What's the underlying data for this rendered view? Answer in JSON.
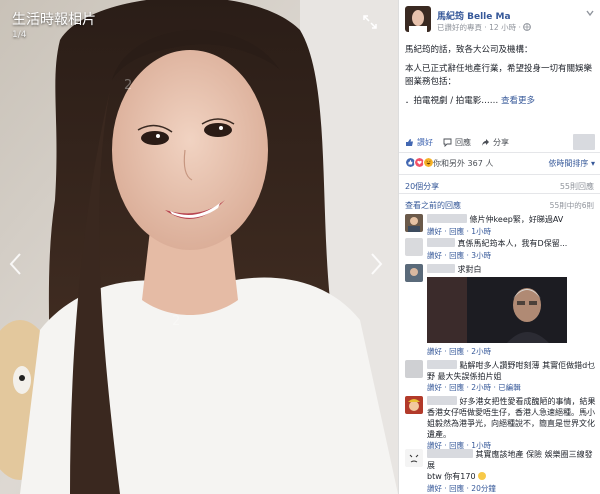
{
  "viewer": {
    "album_title": "生活時報相片",
    "page_counter": "1/4",
    "watermark_a": "2",
    "watermark_b": "2"
  },
  "post": {
    "author": "馬紀筠 Belle Ma",
    "meta": "已讚好的專頁 · 12 小時 ·",
    "paragraphs": [
      "馬紀筠的話，致各大公司及機構：",
      "本人已正式辭任地產行業，希望投身一切有關娛樂圈業務包括：",
      "．拍電視劇 / 拍電影……"
    ],
    "see_more": "查看更多"
  },
  "actions": {
    "like": "讚好",
    "comment": "回應",
    "share": "分享"
  },
  "reactions": {
    "summary": "你和另外 367 人",
    "order": "依時間排序"
  },
  "shares": "20個分享",
  "replies_link": "20個回應",
  "replies_count": "55則回應",
  "view_previous": "查看之前的回應",
  "comment_count": "55則中的6則",
  "comments": [
    {
      "text": "條片仲keep緊，好睇過AV",
      "reply": "讚好 · 回應 · 1小時"
    },
    {
      "text": "真係馬紀筠本人，我有D保留...",
      "reply": "讚好 · 回應 · 3小時"
    },
    {
      "text": "求對白",
      "reply": "讚好 · 回應 · 2小時"
    },
    {
      "text": "點解咁多人讚野咁刻薄 其實佢做錯d乜野 最大失誤係拍片姐",
      "reply": "讚好 · 回應 · 2小時 · 已編輯"
    },
    {
      "text": "好多港女把性愛看成醜陋的事情，結果香港女仔唔做愛唔生仔，香港人急速絕種。馬小姐毅然為港爭光，向絕種說不，簡直是世界文化遺產。",
      "reply": "讚好 · 回應 · 1小時"
    },
    {
      "text": "其實應該地產 保險 娛樂圈三線發展",
      "text2": "btw 你有170",
      "reply": "讚好 · 回應 · 20分鐘"
    }
  ],
  "colors": {
    "link": "#365899",
    "meta": "#90949c",
    "like_blue": "#4267b2",
    "love_red": "#f25268",
    "haha_yellow": "#f7b125"
  }
}
